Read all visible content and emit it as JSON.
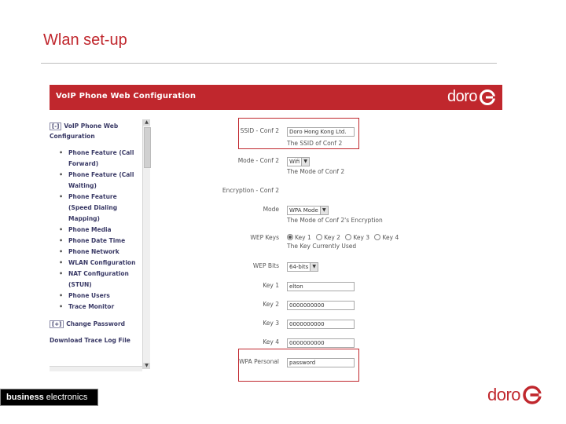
{
  "slide": {
    "title": "Wlan set-up",
    "footer_badge_bold": "business",
    "footer_badge_rest": " electronics",
    "footer_logo": "doro"
  },
  "colors": {
    "accent": "#c0272d",
    "sidebar_text": "#3a3a66"
  },
  "app": {
    "header_title": "VoIP Phone Web Configuration",
    "logo_text": "doro",
    "logo_icon": "doro-swirl-icon"
  },
  "sidebar": {
    "section_marker": "[-]",
    "section_label": "VoIP Phone Web Configuration",
    "items": [
      "Phone Feature (Call Forward)",
      "Phone Feature (Call Waiting)",
      "Phone Feature (Speed Dialing Mapping)",
      "Phone Media",
      "Phone Date Time",
      "Phone Network",
      "WLAN Configuration",
      "NAT Configuration (STUN)",
      "Phone Users",
      "Trace Monitor"
    ],
    "change_password_marker": "[+]",
    "change_password": "Change Password",
    "download_trace": "Download Trace Log File"
  },
  "form": {
    "ssid_label": "SSID - Conf 2",
    "ssid_value": "Doro Hong Kong Ltd.",
    "ssid_hint": "The SSID of Conf 2",
    "mode_label": "Mode - Conf 2",
    "mode_value": "Wifi",
    "mode_hint": "The Mode of Conf 2",
    "encryption_label": "Encryption - Conf 2",
    "enc_mode_label": "Mode",
    "enc_mode_value": "WPA Mode",
    "enc_mode_hint": "The Mode of Conf 2's Encryption",
    "wep_keys_label": "WEP Keys",
    "wep_keys_options": [
      "Key 1",
      "Key 2",
      "Key 3",
      "Key 4"
    ],
    "wep_keys_selected": "Key 1",
    "wep_keys_hint": "The Key Currently Used",
    "wep_bits_label": "WEP Bits",
    "wep_bits_value": "64-bits",
    "key1_label": "Key 1",
    "key1_value": "elton",
    "key2_label": "Key 2",
    "key2_value": "0000000000",
    "key3_label": "Key 3",
    "key3_value": "0000000000",
    "key4_label": "Key 4",
    "key4_value": "0000000000",
    "wpa_label": "WPA Personal",
    "wpa_value": "password"
  }
}
